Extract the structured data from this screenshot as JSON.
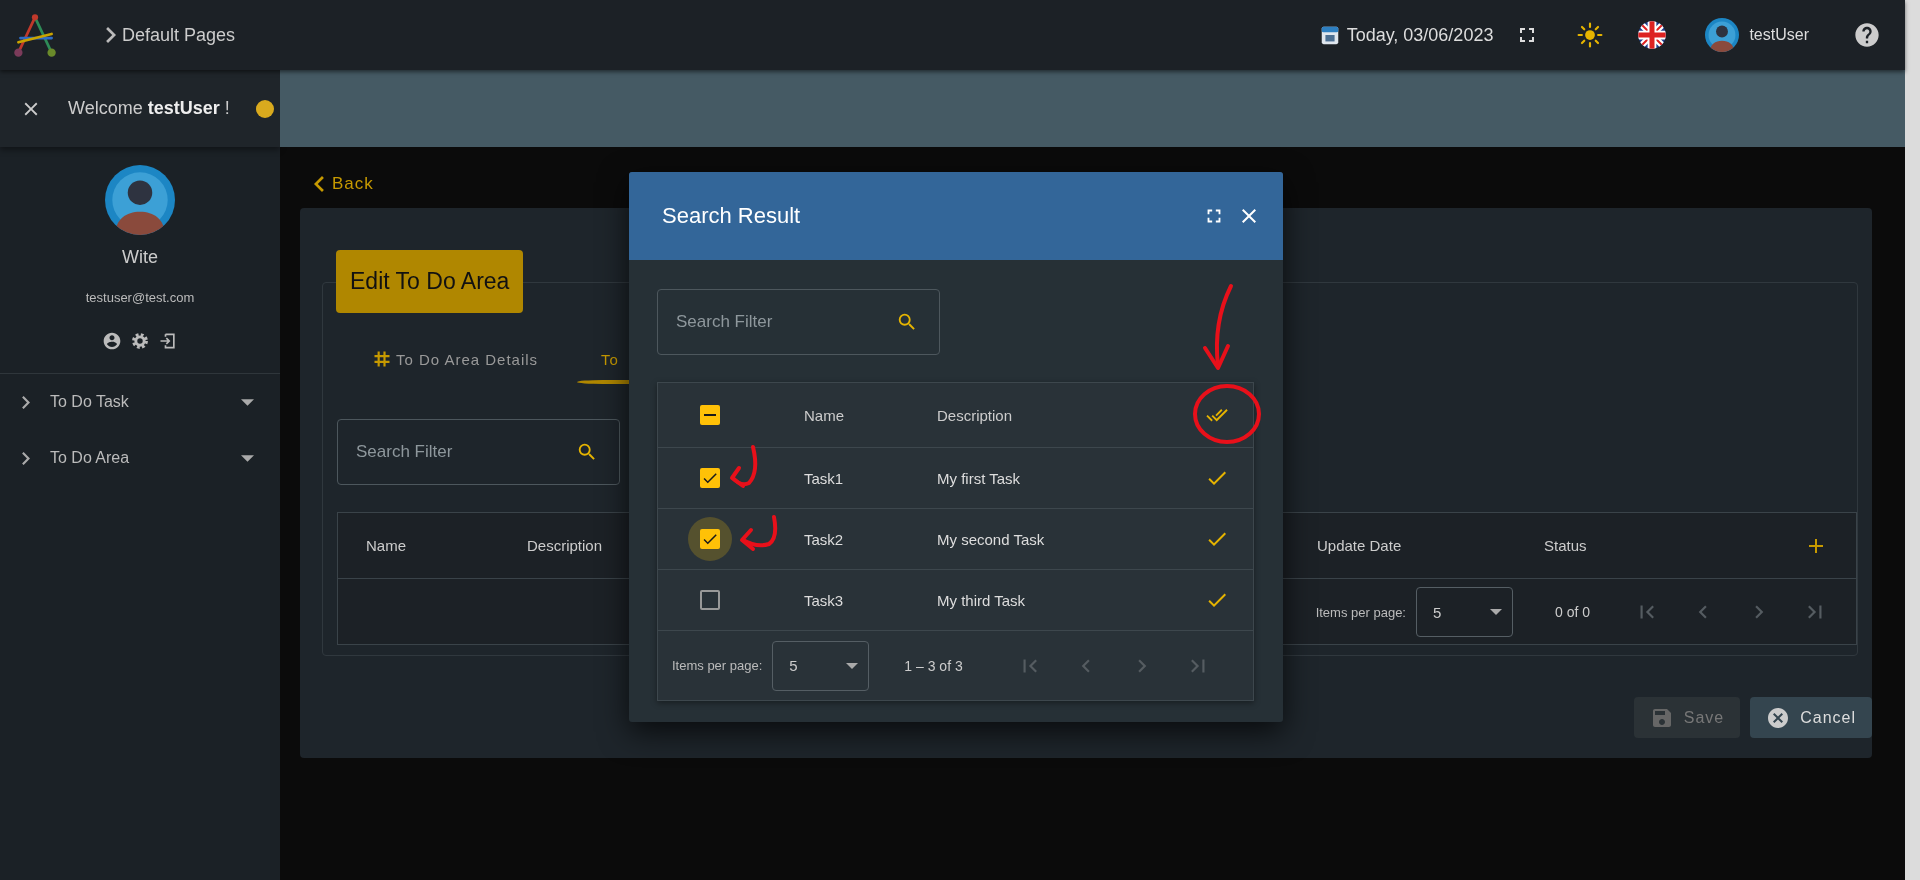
{
  "top_bar": {
    "breadcrumb": "Default Pages",
    "date": "Today, 03/06/2023",
    "user_name": "testUser"
  },
  "sidebar": {
    "welcome": "Welcome **testUser** !",
    "toggle_on": true,
    "profile": {
      "name": "Wite",
      "email": "testuser@test.com"
    },
    "menu": [
      {
        "label": "To Do Task",
        "expanded": false
      },
      {
        "label": "To Do Area",
        "expanded": false
      }
    ]
  },
  "back_link": "Back",
  "form": {
    "title": "Edit To Do Area",
    "tabs": [
      {
        "label": "To Do Area Details",
        "selected": false
      },
      {
        "label": "To",
        "selected": true
      }
    ],
    "search": {
      "placeholder": "Search Filter"
    },
    "table": {
      "columns": [
        "Name",
        "Description",
        "Update Date",
        "Status"
      ]
    },
    "paginator": {
      "label": "Items per page:",
      "page_size": "5",
      "range": "0 of 0"
    },
    "buttons": [
      {
        "label": "Save",
        "kind": "save",
        "disabled": true
      },
      {
        "label": "Cancel",
        "kind": "cancel",
        "disabled": false
      }
    ]
  },
  "dialog": {
    "title": "Search Result",
    "search": {
      "placeholder": "Search Filter"
    },
    "table": {
      "select_all_indeterminate": true,
      "columns": [
        "Name",
        "Description"
      ],
      "rows": [
        {
          "name": "Task1",
          "description": "My first Task",
          "checked": true,
          "focused": false,
          "done": true
        },
        {
          "name": "Task2",
          "description": "My second Task",
          "checked": true,
          "focused": true,
          "done": true
        },
        {
          "name": "Task3",
          "description": "My third Task",
          "checked": false,
          "focused": false,
          "done": true
        }
      ]
    },
    "paginator": {
      "label": "Items per page:",
      "page_size": "5",
      "range": "1 – 3 of 3"
    }
  }
}
